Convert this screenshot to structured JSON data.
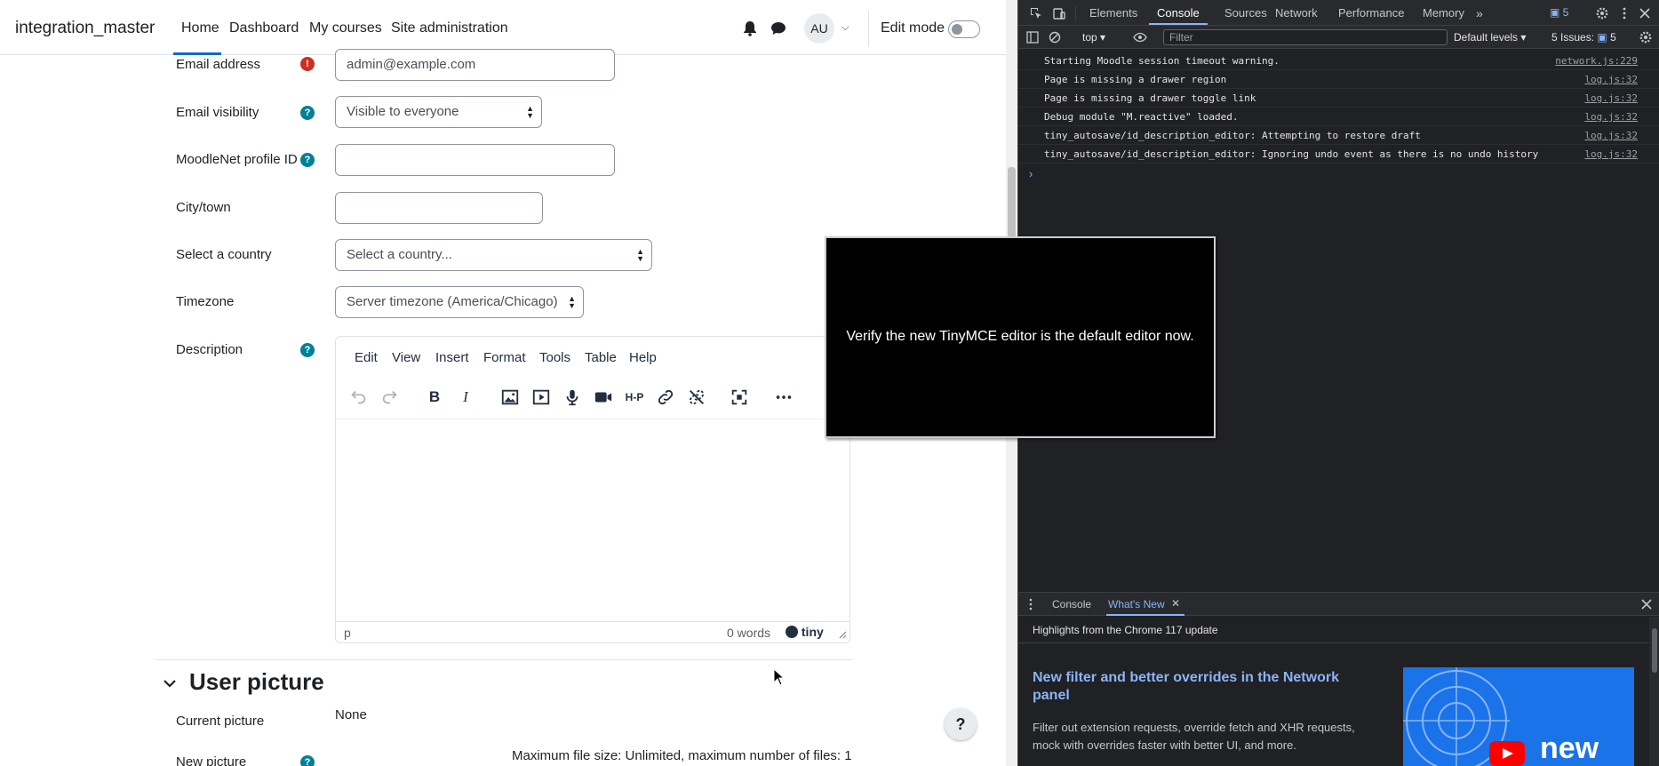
{
  "navbar": {
    "brand": "integration_master",
    "links": [
      "Home",
      "Dashboard",
      "My courses",
      "Site administration"
    ],
    "avatar_initials": "AU",
    "edit_mode_label": "Edit mode",
    "edit_mode_on": false
  },
  "form": {
    "email": {
      "label": "Email address",
      "value": "admin@example.com"
    },
    "email_visibility": {
      "label": "Email visibility",
      "value": "Visible to everyone"
    },
    "moodlenet": {
      "label": "MoodleNet profile ID",
      "value": ""
    },
    "city": {
      "label": "City/town",
      "value": ""
    },
    "country": {
      "label": "Select a country",
      "value": "Select a country..."
    },
    "timezone": {
      "label": "Timezone",
      "value": "Server timezone (America/Chicago)"
    },
    "description": {
      "label": "Description"
    }
  },
  "editor": {
    "menu": [
      "Edit",
      "View",
      "Insert",
      "Format",
      "Tools",
      "Table",
      "Help"
    ],
    "toolbar_icons": [
      "undo-icon",
      "redo-icon",
      "bold-icon",
      "italic-icon",
      "image-icon",
      "media-icon",
      "record-audio-icon",
      "record-video-icon",
      "h5p-icon",
      "link-icon",
      "unlink-icon",
      "fullscreen-icon",
      "more-icon"
    ],
    "bold_glyph": "B",
    "italic_glyph": "I",
    "h5p_glyph": "H-P",
    "status_path": "p",
    "word_count": "0 words",
    "brand": "tiny"
  },
  "user_picture": {
    "section_title": "User picture",
    "current_label": "Current picture",
    "current_value": "None",
    "new_label": "New picture",
    "max_size_text": "Maximum file size: Unlimited, maximum number of files: 1"
  },
  "help_fab": "?",
  "overlay": {
    "text": "Verify the new TinyMCE editor is the default editor now."
  },
  "devtools": {
    "tabs": [
      "Elements",
      "Console",
      "Sources",
      "Network",
      "Performance",
      "Memory"
    ],
    "active_tab": "Console",
    "issues_badge": "5",
    "context": "top",
    "filter_placeholder": "Filter",
    "levels": "Default levels",
    "issues_label": "5 Issues:",
    "issues_count": "5",
    "logs": [
      {
        "msg": "Starting Moodle session timeout warning.",
        "src": "network.js:229"
      },
      {
        "msg": "Page is missing a drawer region",
        "src": "log.js:32"
      },
      {
        "msg": "Page is missing a drawer toggle link",
        "src": "log.js:32"
      },
      {
        "msg": "Debug module \"M.reactive\" loaded.",
        "src": "log.js:32"
      },
      {
        "msg": "tiny_autosave/id_description_editor: Attempting to restore draft",
        "src": "log.js:32"
      },
      {
        "msg": "tiny_autosave/id_description_editor: Ignoring undo event as there is no undo history",
        "src": "log.js:32"
      }
    ],
    "prompt": "›",
    "drawer": {
      "tabs": [
        "Console",
        "What's New"
      ],
      "active": "What's New",
      "heading": "Highlights from the Chrome 117 update",
      "article_title": "New filter and better overrides in the Network panel",
      "article_desc": "Filter out extension requests, override fetch and XHR requests, mock with overrides faster with better UI, and more.",
      "thumb_word": "new"
    }
  },
  "colors": {
    "accent": "#0f6cbf",
    "help": "#008196",
    "required": "#ca3120",
    "devtools_bg": "#202124",
    "devtools_link": "#8ab4f8"
  }
}
